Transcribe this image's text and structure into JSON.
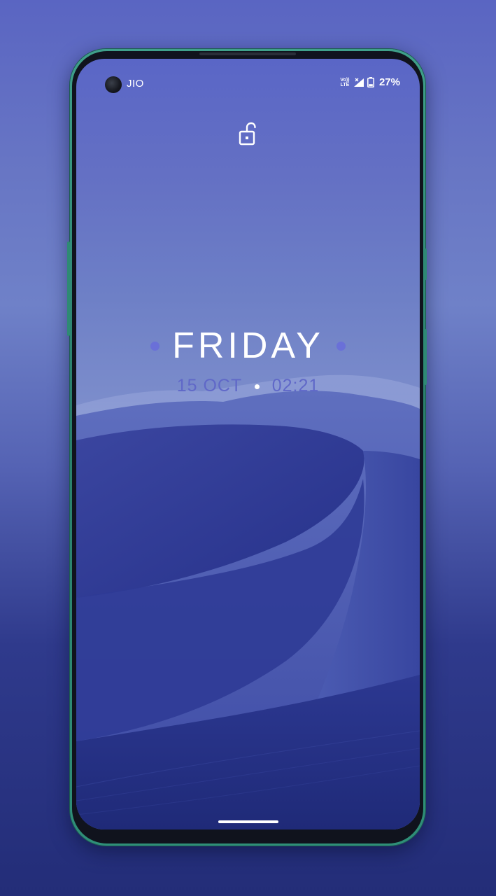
{
  "status_bar": {
    "carrier": "JIO",
    "network_label_top": "Vo))",
    "network_label_bottom": "LTE",
    "battery_percent": "27%"
  },
  "lock_screen": {
    "day": "FRIDAY",
    "date": "15 OCT",
    "time": "02:21"
  },
  "icons": {
    "lock": "unlocked-padlock-icon",
    "signal": "signal-icon",
    "battery": "battery-icon",
    "camera": "front-camera"
  },
  "colors": {
    "accent_dot": "#6a70d8",
    "frame": "#2f8f78"
  }
}
